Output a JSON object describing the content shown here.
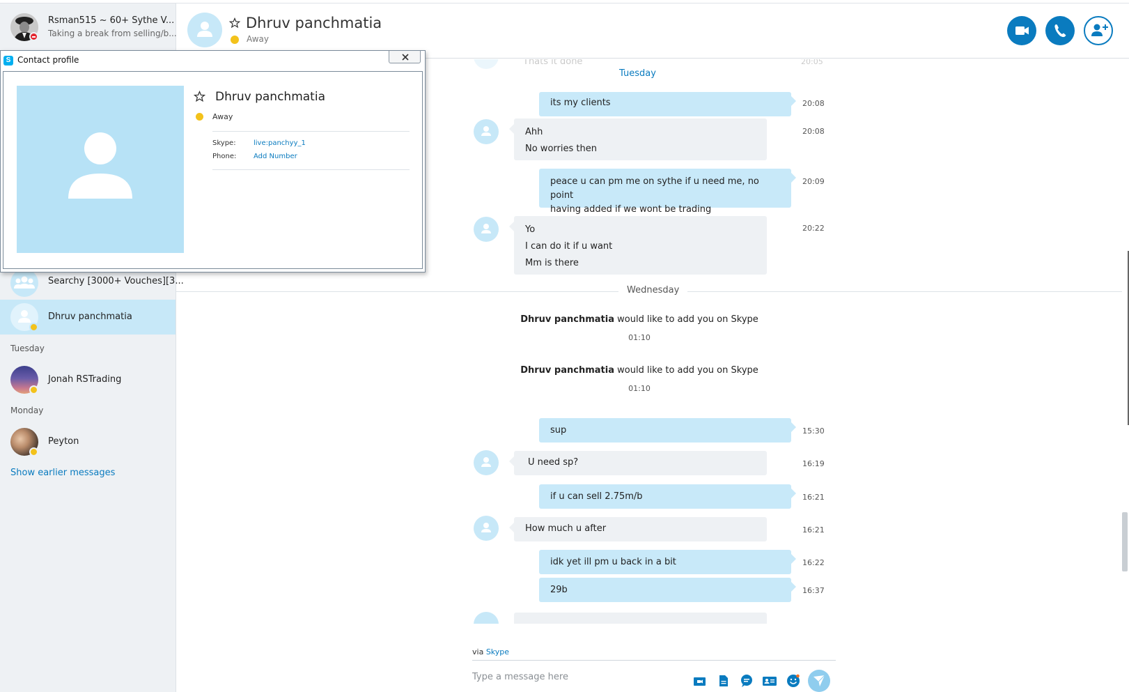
{
  "sidebar": {
    "account": {
      "name": "Rsman515 ~ 60+ Sythe V...",
      "mood": "Taking a break from selling/b..."
    },
    "conversations": [
      {
        "name": "Searchy [3000+ Vouches][3...",
        "type": "group"
      },
      {
        "name": "Dhruv panchmatia",
        "type": "contact",
        "status": "away",
        "selected": true
      }
    ],
    "groups": [
      {
        "header": "Tuesday",
        "items": [
          {
            "name": "Jonah RSTrading",
            "status": "away"
          }
        ]
      },
      {
        "header": "Monday",
        "items": [
          {
            "name": "Peyton",
            "status": "away"
          }
        ]
      }
    ],
    "show_earlier": "Show earlier messages"
  },
  "header": {
    "contact_name": "Dhruv panchmatia",
    "status": "Away",
    "buttons": {
      "video": "video-call-icon",
      "call": "phone-icon",
      "add": "add-people-icon"
    }
  },
  "dialog": {
    "title": "Contact profile",
    "contact_name": "Dhruv panchmatia",
    "status": "Away",
    "skype_label": "Skype:",
    "skype_value": "live:panchyy_1",
    "phone_label": "Phone:",
    "phone_value": "Add Number"
  },
  "chat": {
    "top_partial": {
      "text": "Thats it done",
      "time": "20:05"
    },
    "day1": "Tuesday",
    "messages1": [
      {
        "dir": "out",
        "lines": [
          "its my clients"
        ],
        "time": "20:08"
      },
      {
        "dir": "in",
        "lines": [
          "Ahh",
          "No worries then"
        ],
        "time": "20:08"
      },
      {
        "dir": "out",
        "lines": [
          "peace u can pm me on sythe if u need me, no point",
          "having added if we wont be trading"
        ],
        "time": "20:09"
      },
      {
        "dir": "in",
        "lines": [
          "Yo",
          "I can do it if u want",
          "Mm is there"
        ],
        "time": "20:22"
      }
    ],
    "day2": "Wednesday",
    "system": [
      {
        "name": "Dhruv panchmatia",
        "text": " would like to add you on Skype",
        "time": "01:10"
      },
      {
        "name": "Dhruv panchmatia",
        "text": " would like to add you on Skype",
        "time": "01:10"
      }
    ],
    "messages2": [
      {
        "dir": "out",
        "lines": [
          "sup"
        ],
        "time": "15:30"
      },
      {
        "dir": "in",
        "lines": [
          "U need sp?"
        ],
        "time": "16:19"
      },
      {
        "dir": "out",
        "lines": [
          "if u can sell 2.75m/b"
        ],
        "time": "16:21"
      },
      {
        "dir": "in",
        "lines": [
          "How much u after"
        ],
        "time": "16:21"
      },
      {
        "dir": "out",
        "lines": [
          "idk yet ill pm u back in a bit"
        ],
        "time": "16:22"
      },
      {
        "dir": "out",
        "lines": [
          "29b"
        ],
        "time": "16:37"
      }
    ]
  },
  "composer": {
    "via_label": "via",
    "via_link": "Skype",
    "placeholder": "Type a message here",
    "icons": [
      "video-message-icon",
      "file-icon",
      "chat-bubble-icon",
      "contact-card-icon",
      "emoticon-icon",
      "send-icon"
    ]
  },
  "colors": {
    "accent": "#0a7bbf",
    "bubble_out": "#c8e9f9",
    "bubble_in": "#eef1f4",
    "away": "#f3c21b"
  }
}
